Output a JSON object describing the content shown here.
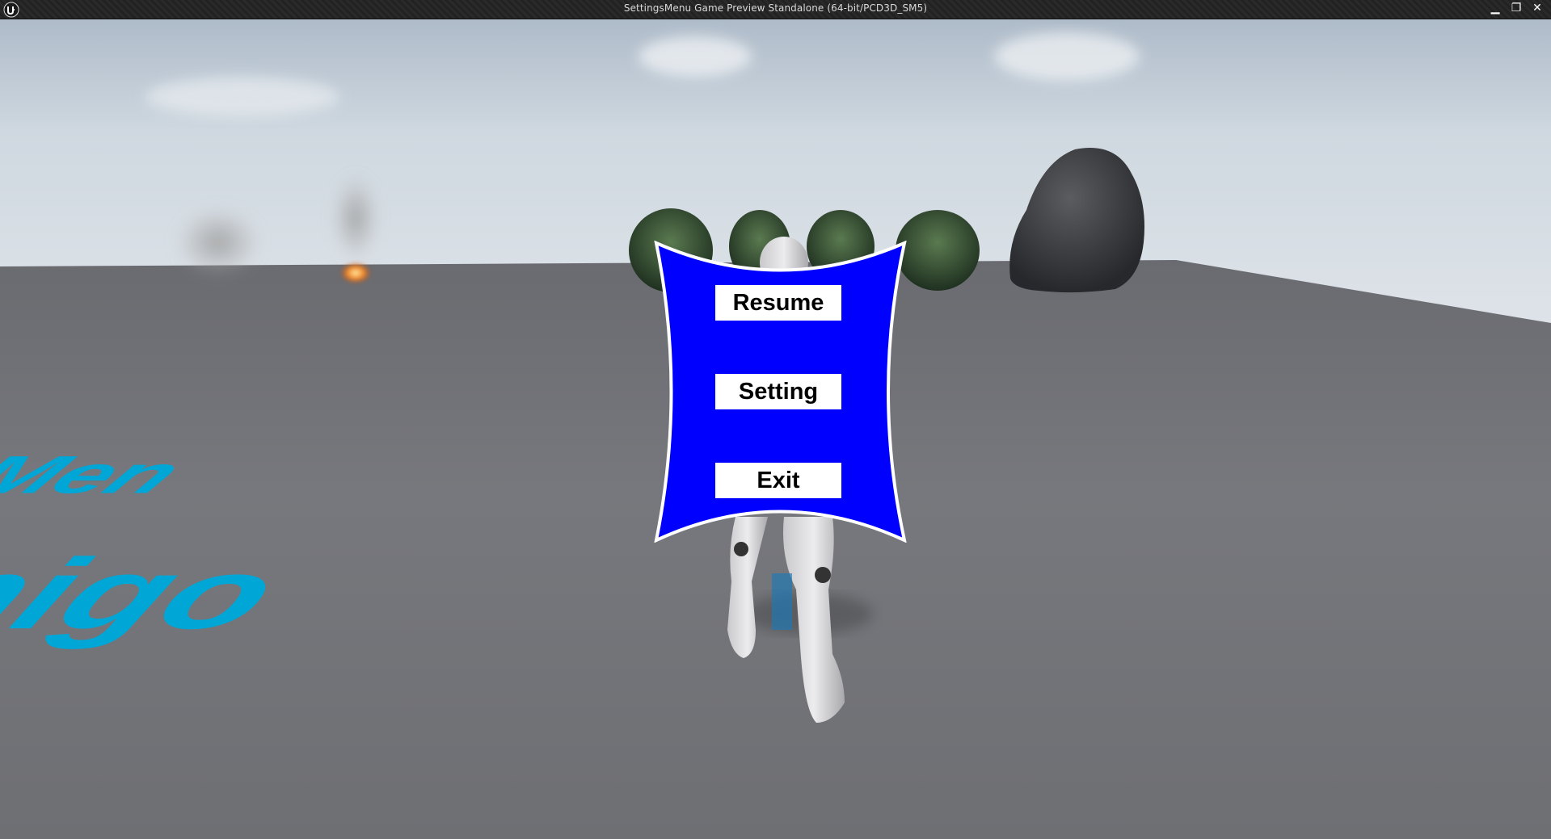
{
  "window": {
    "title": "SettingsMenu Game Preview Standalone (64-bit/PCD3D_SM5)",
    "controls": {
      "minimize_glyph": "▁",
      "restore_glyph": "❐",
      "close_glyph": "✕"
    }
  },
  "scene": {
    "ground_text_line1": "ings Men",
    "ground_text_line2": "Smigo",
    "ground_text_color": "#00a6d6"
  },
  "menu": {
    "background_color": "#0000ff",
    "buttons": [
      {
        "label": "Resume"
      },
      {
        "label": "Setting"
      },
      {
        "label": "Exit"
      }
    ]
  }
}
